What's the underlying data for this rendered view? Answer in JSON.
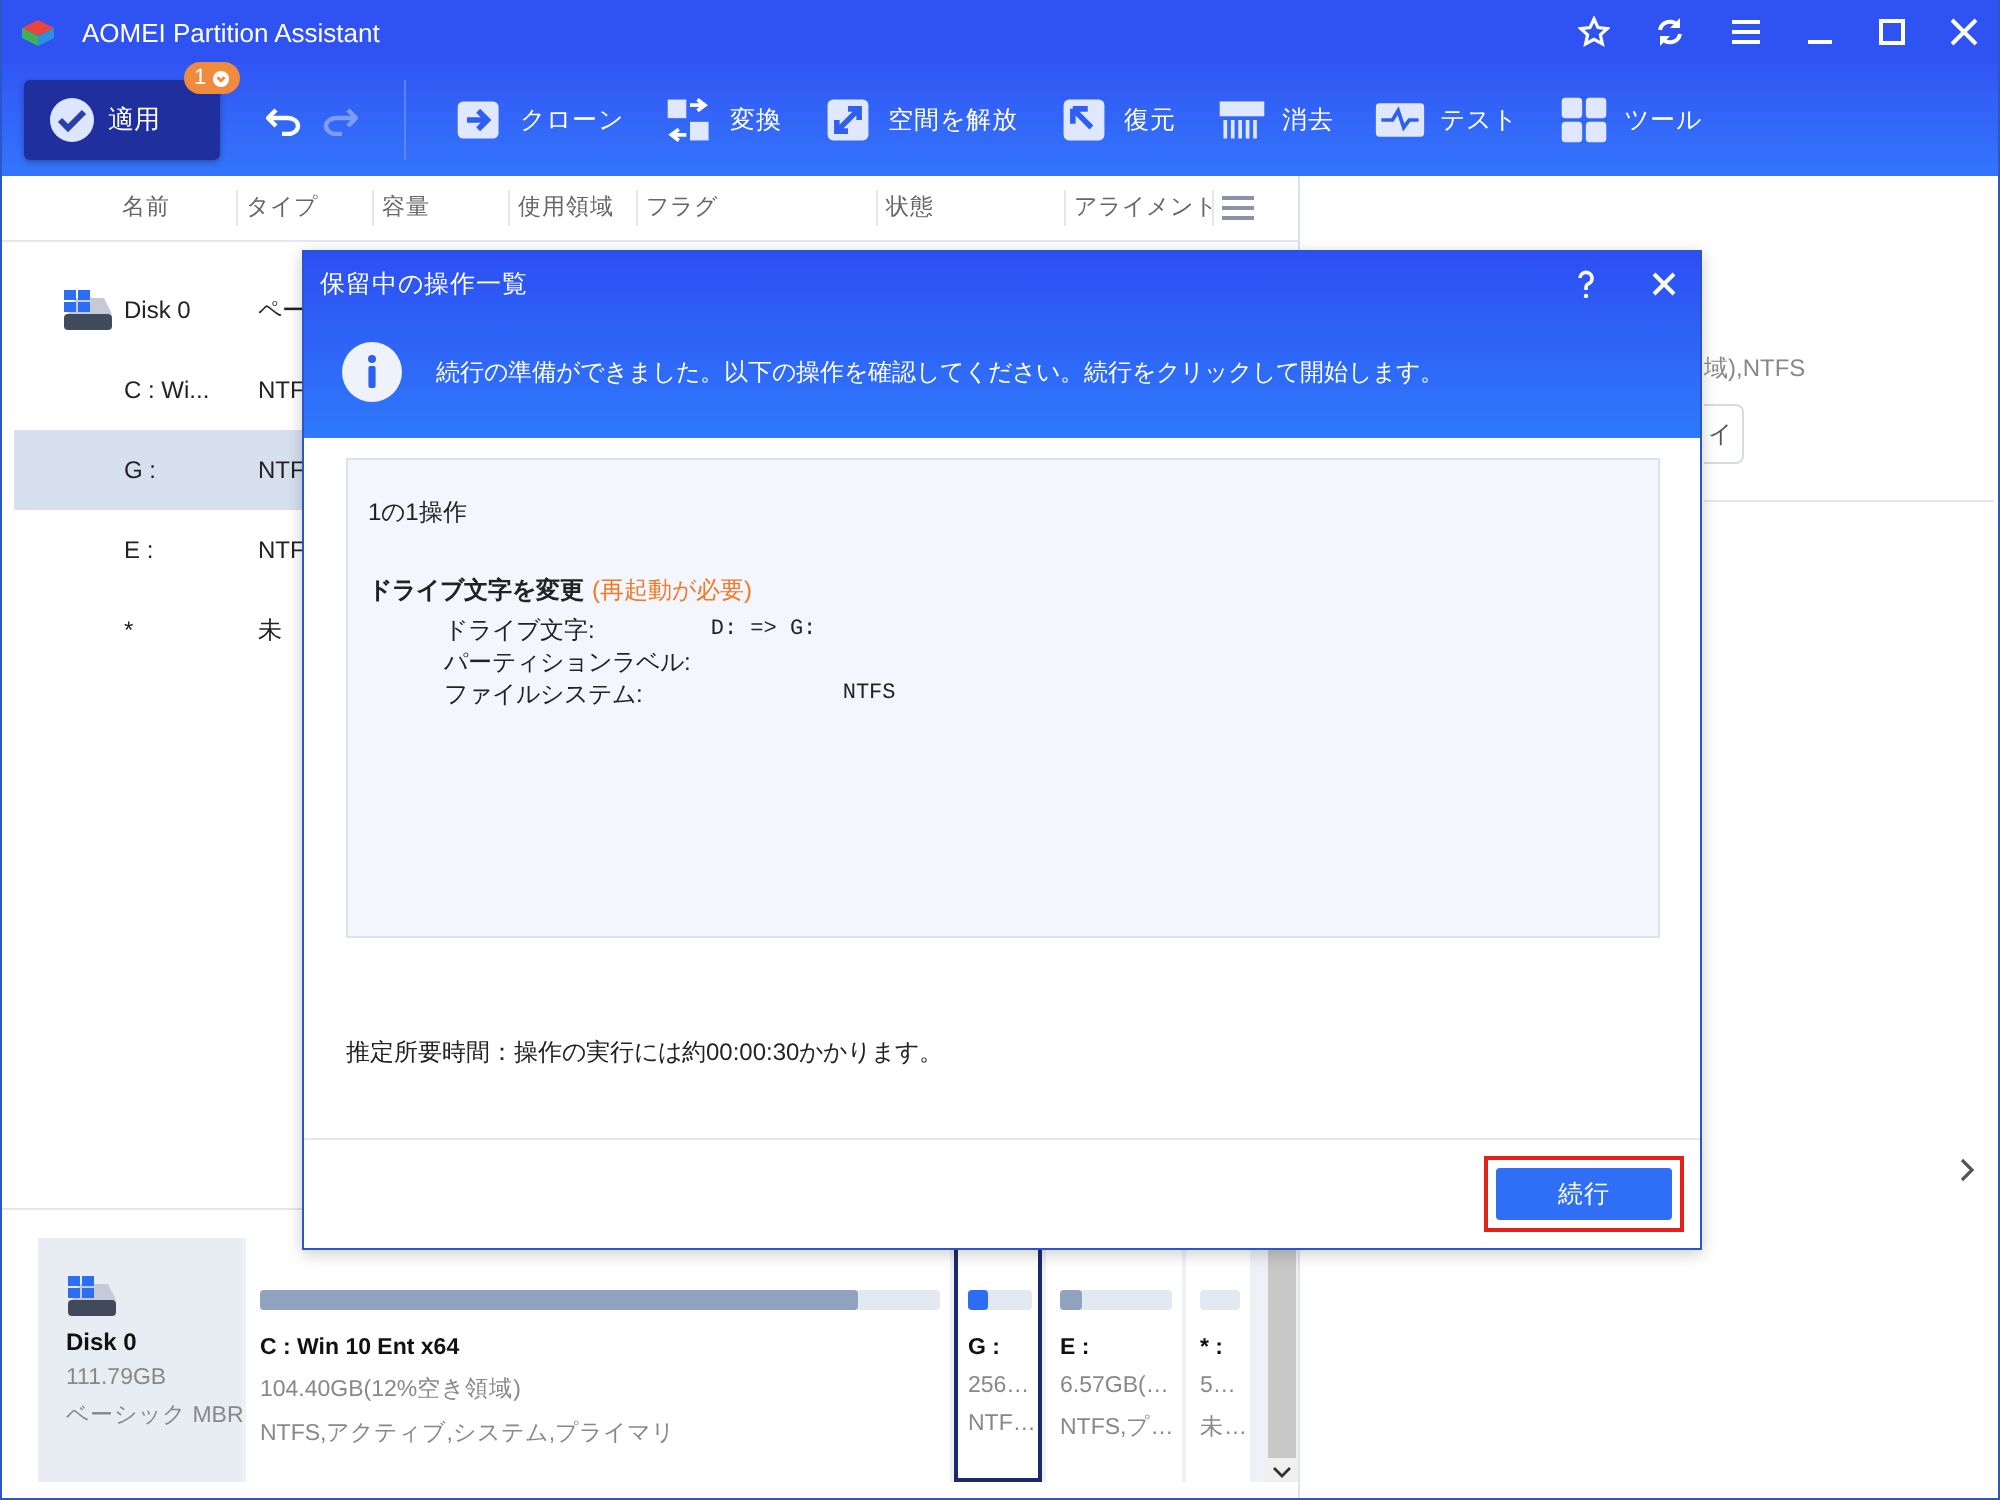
{
  "window": {
    "title": "AOMEI Partition Assistant"
  },
  "toolbar": {
    "apply": {
      "label": "適用",
      "badge": "1"
    },
    "tools": [
      {
        "label": "クローン"
      },
      {
        "label": "変換"
      },
      {
        "label": "空間を解放"
      },
      {
        "label": "復元"
      },
      {
        "label": "消去"
      },
      {
        "label": "テスト"
      },
      {
        "label": "ツール"
      }
    ]
  },
  "table": {
    "columns": [
      "名前",
      "タイプ",
      "容量",
      "使用領域",
      "フラグ",
      "状態",
      "アライメント"
    ],
    "rows": [
      {
        "kind": "disk",
        "name": "Disk 0",
        "type": "ペー",
        "selected": false
      },
      {
        "kind": "partition",
        "name": "C : Wi...",
        "type": "NTF",
        "selected": false
      },
      {
        "kind": "partition",
        "name": "G :",
        "type": "NTF",
        "selected": true
      },
      {
        "kind": "partition",
        "name": "E :",
        "type": "NTF",
        "selected": false
      },
      {
        "kind": "partition",
        "name": "*",
        "type": "未",
        "selected": false
      }
    ]
  },
  "details_panel": {
    "info": "域),NTFS",
    "button": "イ"
  },
  "disk_map": {
    "disk": {
      "name": "Disk 0",
      "size": "111.79GB",
      "type": "ベーシック MBR"
    },
    "partitions": [
      {
        "name": "C : Win 10 Ent x64",
        "size": "104.40GB(12%空き領域)",
        "info": "NTFS,アクティブ,システム,プライマリ",
        "level": 0.88,
        "selected": false
      },
      {
        "name": "G :",
        "size": "256…",
        "info": "NTF…",
        "level": 0.3,
        "selected": true
      },
      {
        "name": "E :",
        "size": "6.57GB(…",
        "info": "NTFS,プ…",
        "level": 0.2,
        "selected": false
      },
      {
        "name": "* :",
        "size": "5…",
        "info": "未…",
        "selected": false
      }
    ]
  },
  "dialog": {
    "title": "保留中の操作一覧",
    "message": "続行の準備ができました。以下の操作を確認してください。続行をクリックして開始します。",
    "count": "1の1操作",
    "operation": "ドライブ文字を変更",
    "note": "(再起動が必要)",
    "details": [
      {
        "label": "ドライブ文字:",
        "value": "D: => G:"
      },
      {
        "label": "パーティションラベル:"
      },
      {
        "label": "ファイルシステム:",
        "value": "NTFS"
      }
    ],
    "estimate": "推定所要時間：操作の実行には約00:00:30かかります。",
    "button": {
      "label": "続行",
      "highlighted": true
    }
  }
}
